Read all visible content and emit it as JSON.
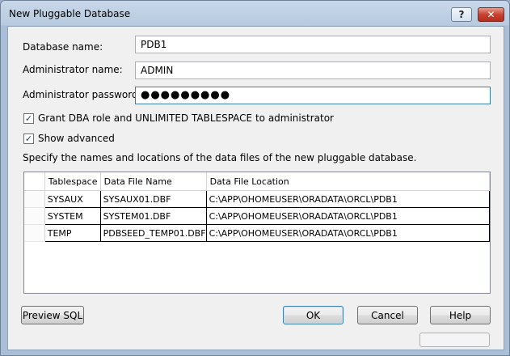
{
  "window": {
    "title": "New Pluggable Database",
    "help_glyph": "?",
    "close_glyph": "✕"
  },
  "form": {
    "db_name_label": "Database name:",
    "db_name_value": "PDB1",
    "admin_name_label": "Administrator name:",
    "admin_name_value": "ADMIN",
    "admin_password_label": "Administrator password:",
    "admin_password_value": "●●●●●●●●●",
    "grant_dba_label": "Grant DBA role and UNLIMITED TABLESPACE to administrator",
    "grant_dba_checked": true,
    "show_advanced_label": "Show advanced",
    "show_advanced_checked": true,
    "check_glyph": "✓",
    "description": "Specify the names and locations of the data files of the new pluggable database."
  },
  "datafiles": {
    "columns": [
      "Tablespace",
      "Data File Name",
      "Data File Location"
    ],
    "rows": [
      {
        "tablespace": "SYSAUX",
        "file": "SYSAUX01.DBF",
        "location": "C:\\APP\\OHOMEUSER\\ORADATA\\ORCL\\PDB1"
      },
      {
        "tablespace": "SYSTEM",
        "file": "SYSTEM01.DBF",
        "location": "C:\\APP\\OHOMEUSER\\ORADATA\\ORCL\\PDB1"
      },
      {
        "tablespace": "TEMP",
        "file": "PDBSEED_TEMP01.DBF",
        "location": "C:\\APP\\OHOMEUSER\\ORADATA\\ORCL\\PDB1"
      }
    ]
  },
  "buttons": {
    "preview_sql": "Preview SQL",
    "ok": "OK",
    "cancel": "Cancel",
    "help": "Help"
  }
}
